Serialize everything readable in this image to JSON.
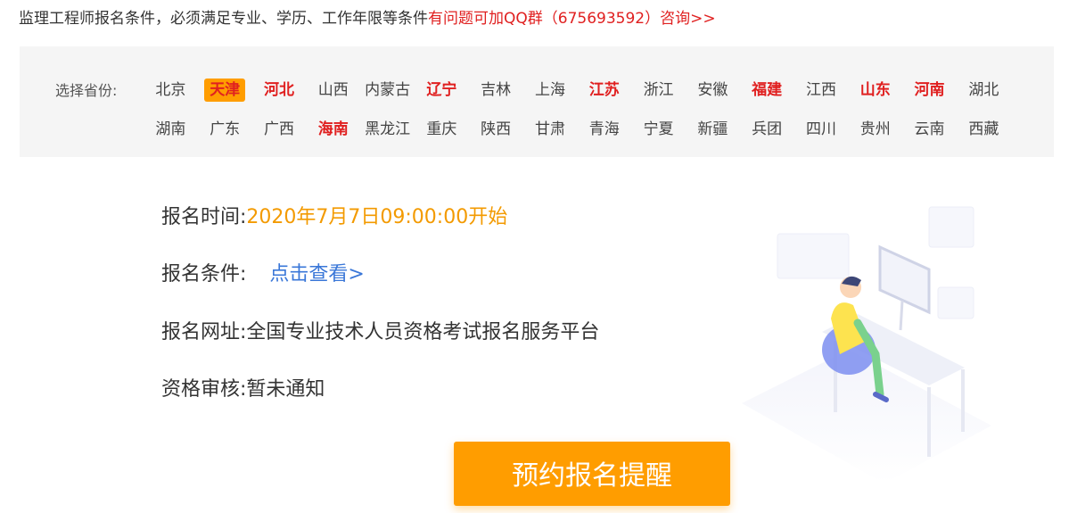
{
  "header": {
    "notice": "监理工程师报名条件，必须满足专业、学历、工作年限等条件",
    "link": "有问题可加QQ群（675693592）咨询>>"
  },
  "province": {
    "label": "选择省份:",
    "rows": [
      [
        {
          "name": "北京",
          "state": "normal"
        },
        {
          "name": "天津",
          "state": "active"
        },
        {
          "name": "河北",
          "state": "hot"
        },
        {
          "name": "山西",
          "state": "normal"
        },
        {
          "name": "内蒙古",
          "state": "normal"
        },
        {
          "name": "辽宁",
          "state": "hot"
        },
        {
          "name": "吉林",
          "state": "normal"
        },
        {
          "name": "上海",
          "state": "normal"
        },
        {
          "name": "江苏",
          "state": "hot"
        },
        {
          "name": "浙江",
          "state": "normal"
        },
        {
          "name": "安徽",
          "state": "normal"
        },
        {
          "name": "福建",
          "state": "hot"
        },
        {
          "name": "江西",
          "state": "normal"
        },
        {
          "name": "山东",
          "state": "hot"
        },
        {
          "name": "河南",
          "state": "hot"
        },
        {
          "name": "湖北",
          "state": "normal"
        }
      ],
      [
        {
          "name": "湖南",
          "state": "normal"
        },
        {
          "name": "广东",
          "state": "normal"
        },
        {
          "name": "广西",
          "state": "normal"
        },
        {
          "name": "海南",
          "state": "hot"
        },
        {
          "name": "黑龙江",
          "state": "normal"
        },
        {
          "name": "重庆",
          "state": "normal"
        },
        {
          "name": "陕西",
          "state": "normal"
        },
        {
          "name": "甘肃",
          "state": "normal"
        },
        {
          "name": "青海",
          "state": "normal"
        },
        {
          "name": "宁夏",
          "state": "normal"
        },
        {
          "name": "新疆",
          "state": "normal"
        },
        {
          "name": "兵团",
          "state": "normal"
        },
        {
          "name": "四川",
          "state": "normal"
        },
        {
          "name": "贵州",
          "state": "normal"
        },
        {
          "name": "云南",
          "state": "normal"
        },
        {
          "name": "西藏",
          "state": "normal"
        }
      ]
    ]
  },
  "info": {
    "time_label": "报名时间:",
    "time_value": "2020年7月7日09:00:00开始",
    "cond_label": "报名条件:",
    "cond_link": "点击查看>",
    "site_label": "报名网址:",
    "site_value": "全国专业技术人员资格考试报名服务平台",
    "review_label": "资格审核:",
    "review_value": "暂未通知"
  },
  "button": {
    "label": "预约报名提醒"
  },
  "colors": {
    "accent": "#ff9d00",
    "hot": "#e02020",
    "link": "#3a77d8",
    "time": "#f39a00"
  },
  "icons": {
    "illustration": "person-at-computer-illustration"
  }
}
